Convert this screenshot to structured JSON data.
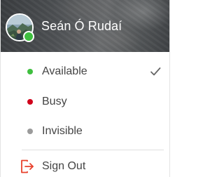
{
  "user": {
    "name": "Seán Ó Rudaí",
    "presence_color": "#3fbf3f"
  },
  "statuses": [
    {
      "label": "Available",
      "color": "#3fbf3f",
      "selected": true
    },
    {
      "label": "Busy",
      "color": "#d0021b",
      "selected": false
    },
    {
      "label": "Invisible",
      "color": "#9b9b9b",
      "selected": false
    }
  ],
  "signout": {
    "label": "Sign Out",
    "icon": "sign-out-icon",
    "color": "#e8412c"
  },
  "icons": {
    "selected": "checkmark-icon",
    "presence": "presence-dot"
  }
}
